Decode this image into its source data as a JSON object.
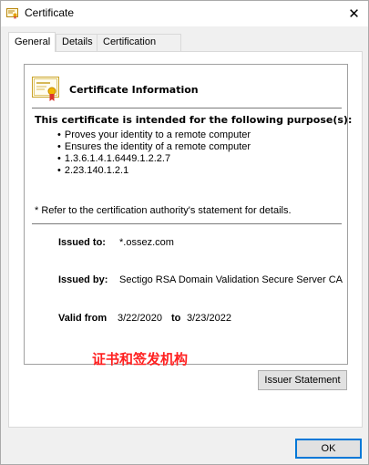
{
  "window": {
    "title": "Certificate",
    "close_glyph": "✕"
  },
  "tabs": [
    {
      "label": "General",
      "active": true
    },
    {
      "label": "Details",
      "active": false
    },
    {
      "label": "Certification Path",
      "active": false
    }
  ],
  "general": {
    "heading": "Certificate Information",
    "purpose_heading": "This certificate is intended for the following purpose(s):",
    "purposes": [
      "Proves your identity to a remote computer",
      "Ensures the identity of a remote computer",
      "1.3.6.1.4.1.6449.1.2.2.7",
      "2.23.140.1.2.1"
    ],
    "refer_note": "* Refer to the certification authority's statement for details.",
    "issued_to_label": "Issued to:",
    "issued_to_value": "*.ossez.com",
    "issued_by_label": "Issued by:",
    "issued_by_value": "Sectigo RSA Domain Validation Secure Server CA",
    "valid_from_label": "Valid from",
    "valid_from_value": "3/22/2020",
    "valid_to_label": "to",
    "valid_to_value": "3/23/2022",
    "annotation": "证书和签发机构",
    "issuer_statement_label": "Issuer Statement"
  },
  "footer": {
    "ok_label": "OK"
  },
  "colors": {
    "annotation": "#ff2020",
    "accent_border": "#0078d7"
  },
  "icons": {
    "title": "certificate-icon",
    "panel": "certificate-icon",
    "close": "close-icon"
  }
}
